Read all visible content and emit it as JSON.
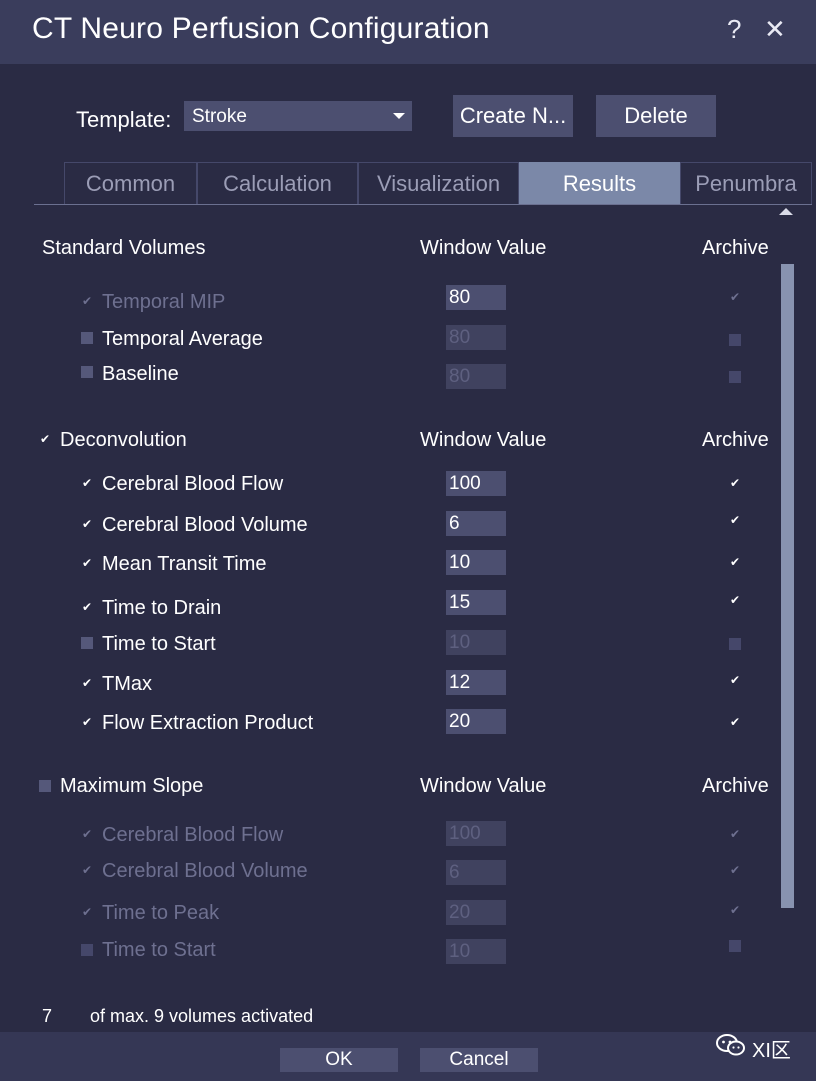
{
  "window": {
    "title": "CT Neuro Perfusion Configuration",
    "help_glyph": "?",
    "close_glyph": "✕"
  },
  "template": {
    "label": "Template:",
    "value": "Stroke",
    "create_label": "Create N...",
    "delete_label": "Delete"
  },
  "tabs": [
    "Common",
    "Calculation",
    "Visualization",
    "Results",
    "Penumbra"
  ],
  "active_tab": "Results",
  "sections": {
    "standard": {
      "title": "Standard Volumes",
      "window_col": "Window Value",
      "archive_col": "Archive",
      "items": [
        {
          "label": "Temporal MIP",
          "value": "80"
        },
        {
          "label": "Temporal Average",
          "value": "80"
        },
        {
          "label": "Baseline",
          "value": "80"
        }
      ]
    },
    "deconvolution": {
      "title": "Deconvolution",
      "window_col": "Window Value",
      "archive_col": "Archive",
      "items": [
        {
          "label": "Cerebral Blood Flow",
          "value": "100"
        },
        {
          "label": "Cerebral Blood Volume",
          "value": "6"
        },
        {
          "label": "Mean Transit Time",
          "value": "10"
        },
        {
          "label": "Time to Drain",
          "value": "15"
        },
        {
          "label": "Time to Start",
          "value": "10"
        },
        {
          "label": "TMax",
          "value": "12"
        },
        {
          "label": "Flow Extraction Product",
          "value": "20"
        }
      ]
    },
    "maxslope": {
      "title": "Maximum Slope",
      "window_col": "Window Value",
      "archive_col": "Archive",
      "items": [
        {
          "label": "Cerebral Blood Flow",
          "value": "100"
        },
        {
          "label": "Cerebral Blood Volume",
          "value": "6"
        },
        {
          "label": "Time to Peak",
          "value": "20"
        },
        {
          "label": "Time to Start",
          "value": "10"
        }
      ]
    }
  },
  "status": {
    "count": "7",
    "text": "of max. 9 volumes activated"
  },
  "footer": {
    "ok_label": "OK",
    "cancel_label": "Cancel",
    "brand": "XI区"
  },
  "icons": {
    "check": "✔",
    "help": "help-icon",
    "close": "close-icon",
    "dropdown": "chevron-down-icon",
    "scroll_up": "scroll-up-icon",
    "brand": "wechat-icon"
  },
  "colors": {
    "background": "#2a2b44",
    "titlebar": "#3a3d5c",
    "active_tab": "#7b88a8",
    "scrollbar": "#8893b0",
    "disabled_text": "#6e7090"
  }
}
